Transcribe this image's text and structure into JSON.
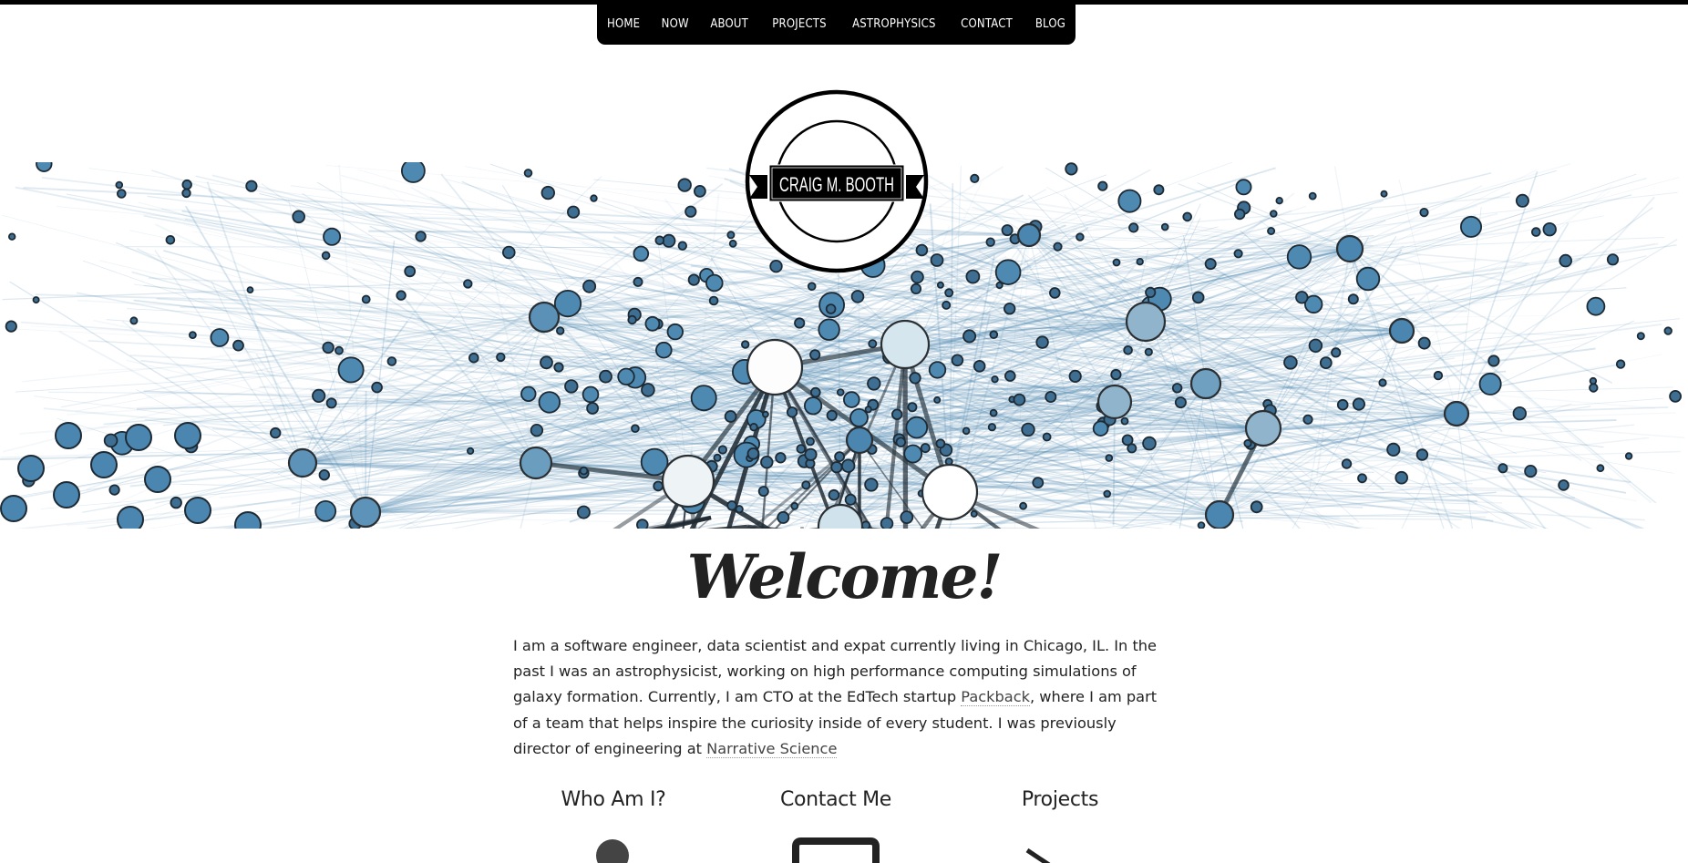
{
  "nav": {
    "items": [
      {
        "label": "HOME"
      },
      {
        "label": "NOW"
      },
      {
        "label": "ABOUT"
      },
      {
        "label": "PROJECTS"
      },
      {
        "label": "ASTROPHYSICS"
      },
      {
        "label": "CONTACT"
      },
      {
        "label": "BLOG"
      }
    ]
  },
  "logo": {
    "text": "CRAIG M. BOOTH"
  },
  "hero": {
    "description_icon": "network-graph-banner",
    "accent": "#4a86b0"
  },
  "welcome": {
    "title": "Welcome!"
  },
  "intro": {
    "part1": "I am a software engineer, data scientist and expat currently living in Chicago, IL. In the past I was an astrophysicist, working on high performance computing simulations of galaxy formation. Currently, I am CTO at the EdTech startup ",
    "link1": "Packback",
    "part2": ", where I am part of a team that helps inspire the curiosity inside of every student. I was previously director of engineering at ",
    "link2": "Narrative Science"
  },
  "sections": [
    {
      "title": "Who Am I?",
      "icon": "person-icon"
    },
    {
      "title": "Contact Me",
      "icon": "envelope-icon"
    },
    {
      "title": "Projects",
      "icon": "code-icon"
    }
  ]
}
